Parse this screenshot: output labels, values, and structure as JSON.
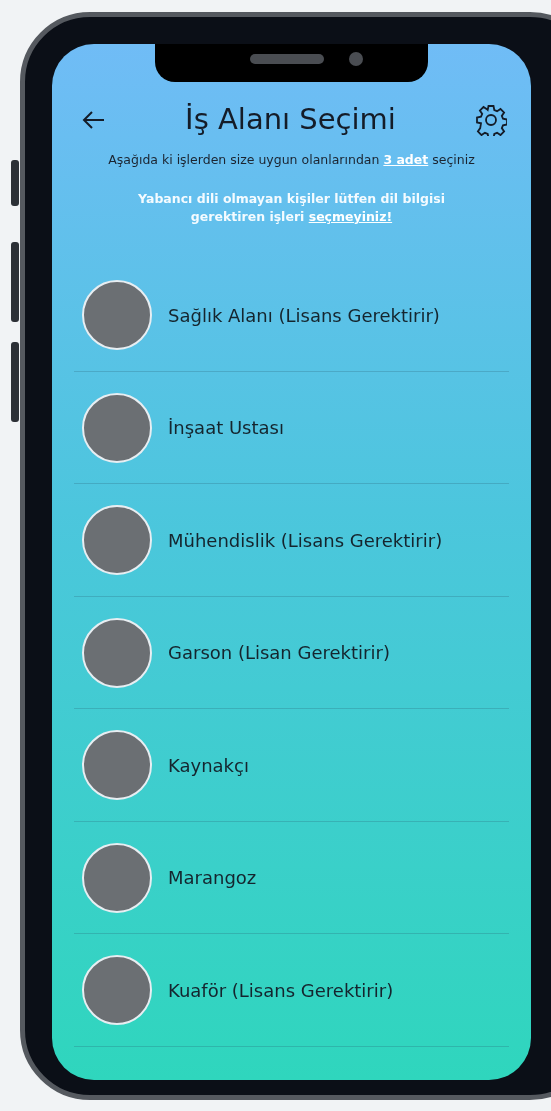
{
  "header": {
    "title": "İş Alanı Seçimi"
  },
  "instruction": {
    "before": "Aşağıda ki işlerden size uygun olanlarından ",
    "link": "3 adet",
    "after": " seçiniz"
  },
  "warning": {
    "before": "Yabancı dili olmayan kişiler lütfen dil bilgisi gerektiren işleri ",
    "link": "seçmeyiniz!"
  },
  "jobs": [
    {
      "label": "Sağlık Alanı (Lisans Gerektirir)"
    },
    {
      "label": "İnşaat Ustası"
    },
    {
      "label": "Mühendislik (Lisans Gerektirir)"
    },
    {
      "label": "Garson (Lisan Gerektirir)"
    },
    {
      "label": "Kaynakçı"
    },
    {
      "label": "Marangoz"
    },
    {
      "label": "Kuaför (Lisans Gerektirir)"
    }
  ]
}
